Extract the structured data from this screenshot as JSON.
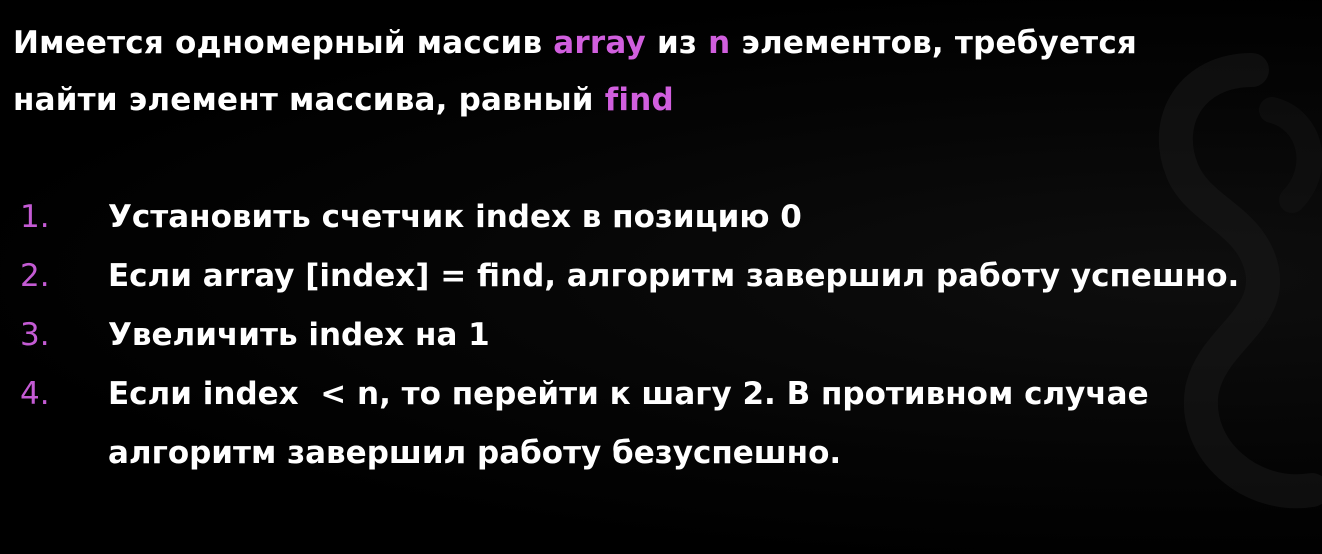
{
  "intro": {
    "part1": "Имеется одномерный массив ",
    "array_term": "array",
    "part2": " из ",
    "n_term": "n",
    "part3": " элементов, требуется",
    "part4": "найти элемент массива, равный ",
    "find_term": "find"
  },
  "steps": [
    {
      "num": "1.",
      "text": "Установить счетчик index в позицию 0"
    },
    {
      "num": "2.",
      "text": "Если array [index] = find, алгоритм завершил работу успешно."
    },
    {
      "num": "3.",
      "text": "Увеличить index на 1"
    },
    {
      "num": "4.",
      "text": "Если index  < n, то перейти к шагу 2. В противном случае алгоритм завершил работу безуспешно."
    }
  ],
  "colors": {
    "background": "#000000",
    "text": "#ffffff",
    "highlight": "#d15fde",
    "step_number": "#c45bd4"
  },
  "icons": {
    "watermark": "logo-watermark-icon"
  }
}
